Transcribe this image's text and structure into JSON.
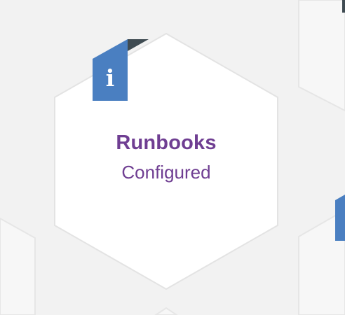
{
  "tile": {
    "title": "Runbooks",
    "subtitle": "Configured",
    "info_icon": "info-icon",
    "info_glyph": "i"
  },
  "colors": {
    "background": "#f2f2f2",
    "hex_fill": "#ffffff",
    "hex_border": "#e3e3e3",
    "title": "#6f3e92",
    "badge": "#4a7fc1",
    "badge_fold": "#3f4b52"
  }
}
